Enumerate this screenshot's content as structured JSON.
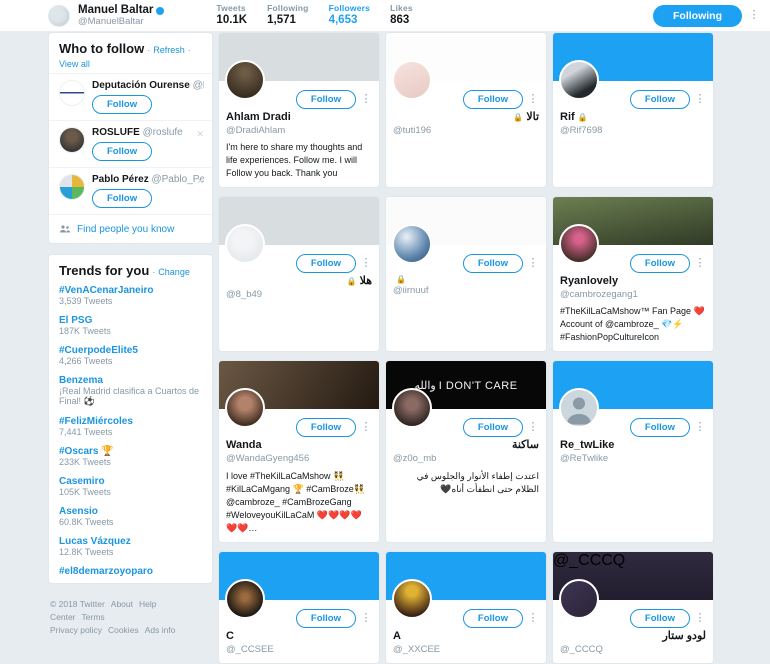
{
  "profile_bar": {
    "name": "Manuel Baltar",
    "handle": "@ManuelBaltar",
    "verified_icon": "verified-badge-icon",
    "stats": [
      {
        "label": "Tweets",
        "value": "10.1K",
        "active": false
      },
      {
        "label": "Following",
        "value": "1,571",
        "active": false
      },
      {
        "label": "Followers",
        "value": "4,653",
        "active": true
      },
      {
        "label": "Likes",
        "value": "863",
        "active": false
      }
    ],
    "following_button": "Following",
    "more_icon": "more-vertical-icon"
  },
  "sidebar": {
    "who_to_follow": {
      "title": "Who to follow",
      "sep": "·",
      "refresh": "Refresh",
      "view_all": "View all",
      "close_icon": "close-icon",
      "follow_label": "Follow",
      "people": [
        {
          "name": "Deputación Ourense",
          "handle": "@De...",
          "avatar": "deputacion-ourense-avatar"
        },
        {
          "name": "ROSLUFE",
          "handle": "@roslufe",
          "avatar": "roslufe-avatar"
        },
        {
          "name": "Pablo Pérez",
          "handle": "@Pablo_PerezP",
          "avatar": "pablo-perez-avatar"
        }
      ],
      "find_people": "Find people you know",
      "find_people_icon": "people-icon"
    },
    "trends": {
      "title": "Trends for you",
      "sep": "·",
      "change": "Change",
      "items": [
        {
          "name": "#VenACenarJaneiro",
          "meta": "3,539 Tweets"
        },
        {
          "name": "El PSG",
          "meta": "187K Tweets"
        },
        {
          "name": "#CuerpodeElite5",
          "meta": "4,266 Tweets"
        },
        {
          "name": "Benzema",
          "meta": "¡Real Madrid clasifica a Cuartos de Final! ⚽"
        },
        {
          "name": "#FelizMiércoles",
          "meta": "7,441 Tweets"
        },
        {
          "name": "#Oscars 🏆",
          "meta": "233K Tweets"
        },
        {
          "name": "Casemiro",
          "meta": "105K Tweets"
        },
        {
          "name": "Asensio",
          "meta": "60.8K Tweets"
        },
        {
          "name": "Lucas Vázquez",
          "meta": "12.8K Tweets"
        },
        {
          "name": "#el8demarzoyoparo",
          "meta": ""
        }
      ]
    },
    "footer": {
      "copyright": "© 2018 Twitter",
      "links": [
        "About",
        "Help Center",
        "Terms",
        "Privacy policy",
        "Cookies",
        "Ads info"
      ]
    }
  },
  "grid": {
    "follow_label": "Follow",
    "more_icon": "more-vertical-icon",
    "lock_icon": "protected-lock-icon",
    "cards": [
      {
        "name": "Ahlam Dradi",
        "handle": "@DradiAhlam",
        "protected": false,
        "bio": "I'm here to share my thoughts and life experiences. Follow me. I will Follow you back. Thank you",
        "banner": "b-grey",
        "avatar": "a-ahlam",
        "banner_text": ""
      },
      {
        "name": "تالا",
        "handle": "@tuti196",
        "protected": true,
        "bio": "",
        "banner": "b-tuti",
        "avatar": "a-tuti",
        "banner_text": ""
      },
      {
        "name": "Rif",
        "handle": "@Rif7698",
        "protected": true,
        "bio": "",
        "banner": "b-rif",
        "avatar": "a-rif",
        "banner_text": ""
      },
      {
        "name": "هلا",
        "handle": "@8_b49",
        "protected": true,
        "bio": "",
        "banner": "b-grey",
        "avatar": "a-b49",
        "banner_text": ""
      },
      {
        "name": "",
        "handle": "@iirnuuf",
        "protected": true,
        "bio": "",
        "banner": "b-white",
        "avatar": "a-iirnuuf",
        "banner_text": ""
      },
      {
        "name": "Ryanlovely",
        "handle": "@cambrozegang1",
        "protected": false,
        "bio": "#TheKilLaCaMshow™ Fan Page ❤️ Account of @cambroze_ 💎⚡ #FashionPopCultureIcon",
        "banner": "b-ryan",
        "avatar": "a-ryan",
        "banner_text": ""
      },
      {
        "name": "Wanda",
        "handle": "@WandaGyeng456",
        "protected": false,
        "bio": "I love #TheKilLaCaMshow 👯 #KilLaCaMgang 🏆 #CamBroze👯 @cambroze_ #CamBrozeGang #WeloveyouKilLaCaM ❤️❤️❤️❤️❤️❤️…",
        "banner": "b-wanda",
        "avatar": "a-wanda",
        "banner_text": ""
      },
      {
        "name": "ساكنة",
        "handle": "@z0o_mb",
        "protected": false,
        "bio": "اعتدت إطفاء الأنوار والجلوس في الظلام حتى انطفأت أناه🖤",
        "banner": "b-dark",
        "avatar": "a-z0o",
        "banner_text": "والله I DON'T CARE"
      },
      {
        "name": "Re_twLike",
        "handle": "@ReTwlike",
        "protected": false,
        "bio": "",
        "banner": "b-blue",
        "avatar": "a-default",
        "banner_text": ""
      },
      {
        "name": "C",
        "handle": "@_CCSEE",
        "protected": false,
        "bio": "",
        "banner": "b-blue",
        "avatar": "a-ccsee",
        "banner_text": ""
      },
      {
        "name": "A",
        "handle": "@_XXCEE",
        "protected": false,
        "bio": "",
        "banner": "b-blue",
        "avatar": "a-xxcee",
        "banner_text": ""
      },
      {
        "name": "لودو ستار",
        "handle": "@_CCCQ",
        "protected": false,
        "bio": "",
        "banner": "b-game",
        "avatar": "a-cccq",
        "banner_text": "@_CCCQ"
      }
    ]
  },
  "colors": {
    "accent": "#1da1f2",
    "link": "#1b95e0",
    "page_bg": "#e6ecf0",
    "text": "#14171a",
    "muted": "#8899a6"
  }
}
